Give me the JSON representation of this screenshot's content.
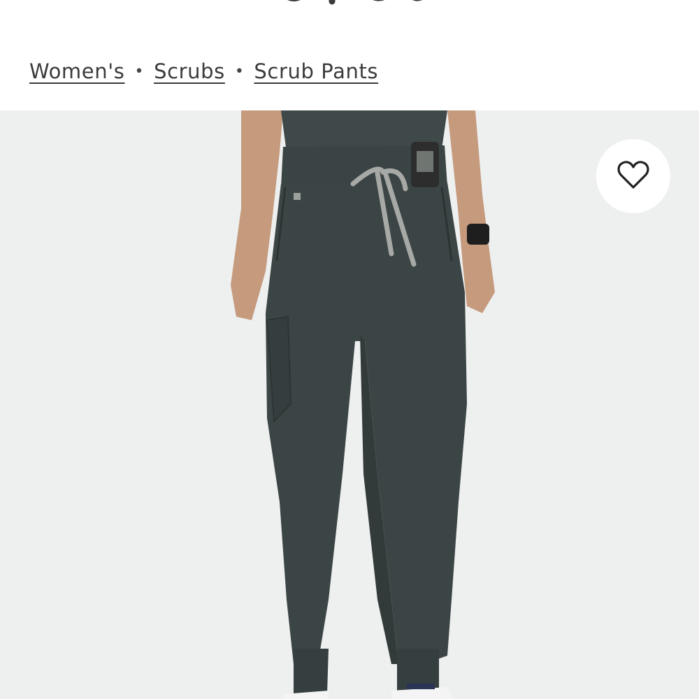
{
  "breadcrumb": {
    "items": [
      {
        "label": "Women's"
      },
      {
        "label": "Scrubs"
      },
      {
        "label": "Scrub Pants"
      }
    ],
    "separator": "•"
  },
  "product_image": {
    "description_colors": {
      "background": "#eeefef",
      "fabric": "#3c4545",
      "drawstring": "#a7a9a6",
      "skin": "#c59a7d"
    }
  },
  "icons": {
    "favorite": "heart-outline-icon"
  }
}
